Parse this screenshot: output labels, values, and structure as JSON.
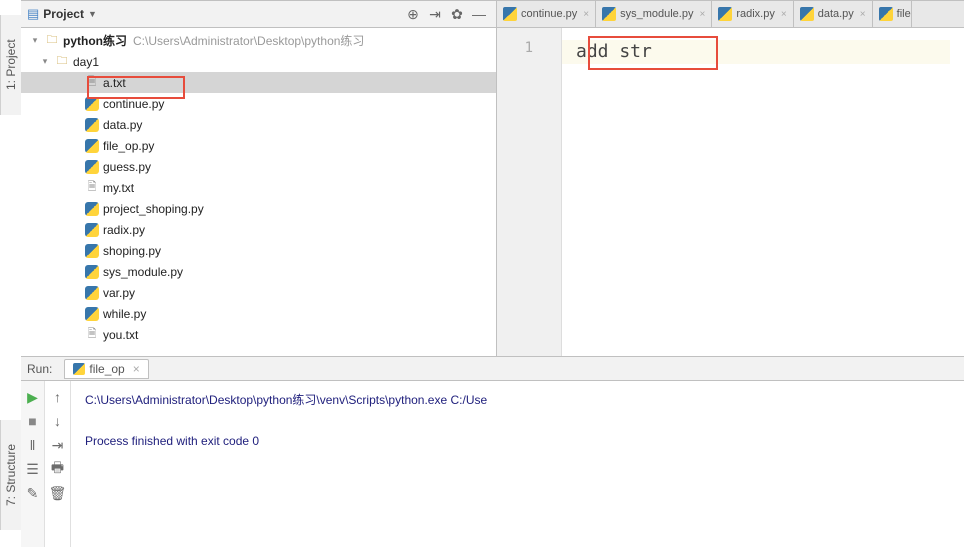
{
  "sidebar": {
    "project_label": "1: Project",
    "structure_label": "7: Structure"
  },
  "project": {
    "title": "Project",
    "root": {
      "name": "python练习",
      "path": "C:\\Users\\Administrator\\Desktop\\python练习"
    },
    "folder": "day1",
    "files": [
      {
        "name": "a.txt",
        "type": "txt",
        "selected": true
      },
      {
        "name": "continue.py",
        "type": "py"
      },
      {
        "name": "data.py",
        "type": "py"
      },
      {
        "name": "file_op.py",
        "type": "py"
      },
      {
        "name": "guess.py",
        "type": "py"
      },
      {
        "name": "my.txt",
        "type": "txt"
      },
      {
        "name": "project_shoping.py",
        "type": "py"
      },
      {
        "name": "radix.py",
        "type": "py"
      },
      {
        "name": "shoping.py",
        "type": "py"
      },
      {
        "name": "sys_module.py",
        "type": "py"
      },
      {
        "name": "var.py",
        "type": "py"
      },
      {
        "name": "while.py",
        "type": "py"
      },
      {
        "name": "you.txt",
        "type": "txt"
      }
    ]
  },
  "editor": {
    "tabs": [
      {
        "label": "continue.py"
      },
      {
        "label": "sys_module.py"
      },
      {
        "label": "radix.py"
      },
      {
        "label": "data.py"
      },
      {
        "label": "file"
      }
    ],
    "line_no": "1",
    "content": "add str"
  },
  "run": {
    "label": "Run:",
    "tab": "file_op",
    "output_line1": "C:\\Users\\Administrator\\Desktop\\python练习\\venv\\Scripts\\python.exe C:/Use",
    "output_line2": "Process finished with exit code 0"
  }
}
